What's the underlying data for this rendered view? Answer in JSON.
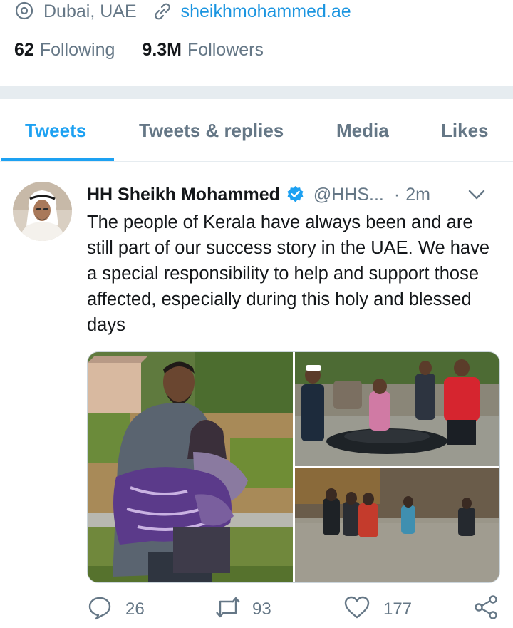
{
  "profile": {
    "location": "Dubai, UAE",
    "url": "sheikhmohammed.ae",
    "following_count": "62",
    "following_label": "Following",
    "followers_count": "9.3M",
    "followers_label": "Followers"
  },
  "tabs": [
    {
      "label": "Tweets",
      "active": true
    },
    {
      "label": "Tweets & replies",
      "active": false
    },
    {
      "label": "Media",
      "active": false
    },
    {
      "label": "Likes",
      "active": false
    }
  ],
  "tweet": {
    "author_name": "HH Sheikh Mohammed",
    "verified": true,
    "handle": "@HHS...",
    "separator": "·",
    "time": "2m",
    "text": "The people of Kerala have always been and are still part of our success story in the UAE. We have a special responsibility to help and support those affected, especially during this holy and blessed days",
    "media": [
      "photo-man-carrying-woman-floodwater",
      "photo-raft-rescue-crowd",
      "photo-people-wading-flood"
    ],
    "actions": {
      "replies": "26",
      "retweets": "93",
      "likes": "177"
    }
  },
  "colors": {
    "accent": "#1da1f2",
    "link": "#1b95e0",
    "secondary_text": "#657786",
    "divider": "#e6ecf0"
  },
  "icons": [
    "location-pin-icon",
    "link-icon",
    "verified-badge-icon",
    "chevron-down-icon",
    "reply-icon",
    "retweet-icon",
    "like-icon",
    "share-icon"
  ]
}
